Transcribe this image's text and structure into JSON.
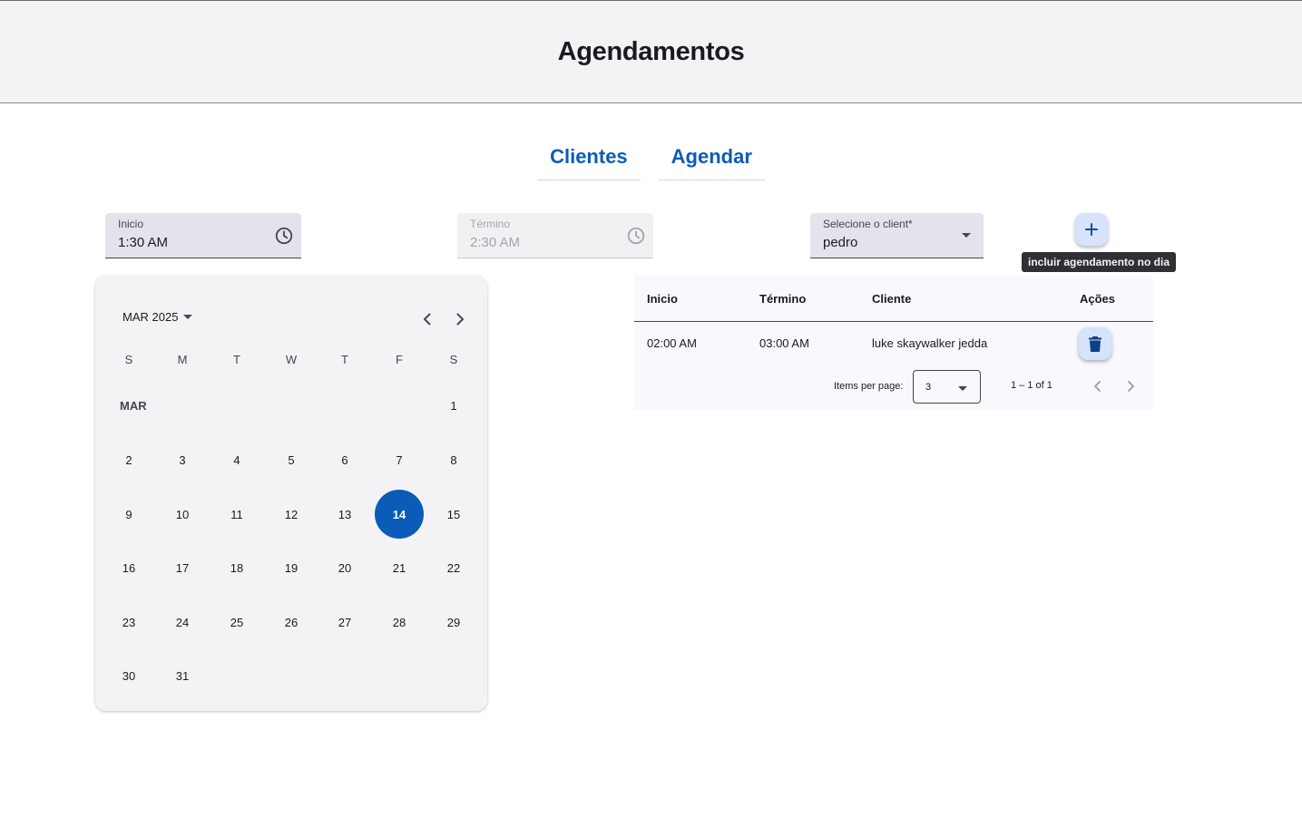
{
  "header": {
    "title": "Agendamentos"
  },
  "nav": {
    "tabs": [
      {
        "label": "Clientes"
      },
      {
        "label": "Agendar"
      }
    ]
  },
  "form": {
    "inicio": {
      "label": "Inicio",
      "value": "1:30 AM",
      "icon": "clock-icon"
    },
    "termino": {
      "label": "Término",
      "value": "2:30 AM",
      "icon": "clock-icon",
      "disabled": true
    },
    "cliente": {
      "label": "Selecione o client*",
      "value": "pedro"
    },
    "add_button": {
      "icon": "plus-icon",
      "tooltip": "incluir agendamento no dia"
    }
  },
  "calendar": {
    "period": "MAR 2025",
    "month_label": "MAR",
    "weekdays": [
      "S",
      "M",
      "T",
      "W",
      "T",
      "F",
      "S"
    ],
    "first_weekday_index": 6,
    "days_in_month": 31,
    "selected_day": 14
  },
  "table": {
    "headers": {
      "inicio": "Inicio",
      "termino": "Término",
      "cliente": "Cliente",
      "acoes": "Ações"
    },
    "rows": [
      {
        "inicio": "02:00 AM",
        "termino": "03:00 AM",
        "cliente": "luke skaywalker jedda",
        "action_icon": "trash-icon"
      }
    ],
    "paginator": {
      "items_per_page_label": "Items per page:",
      "items_per_page": "3",
      "range": "1 – 1 of 1"
    }
  },
  "colors": {
    "primary": "#0b5cb8",
    "header_bg": "#f3f3f6",
    "tonal_button": "#d7e3fb"
  }
}
